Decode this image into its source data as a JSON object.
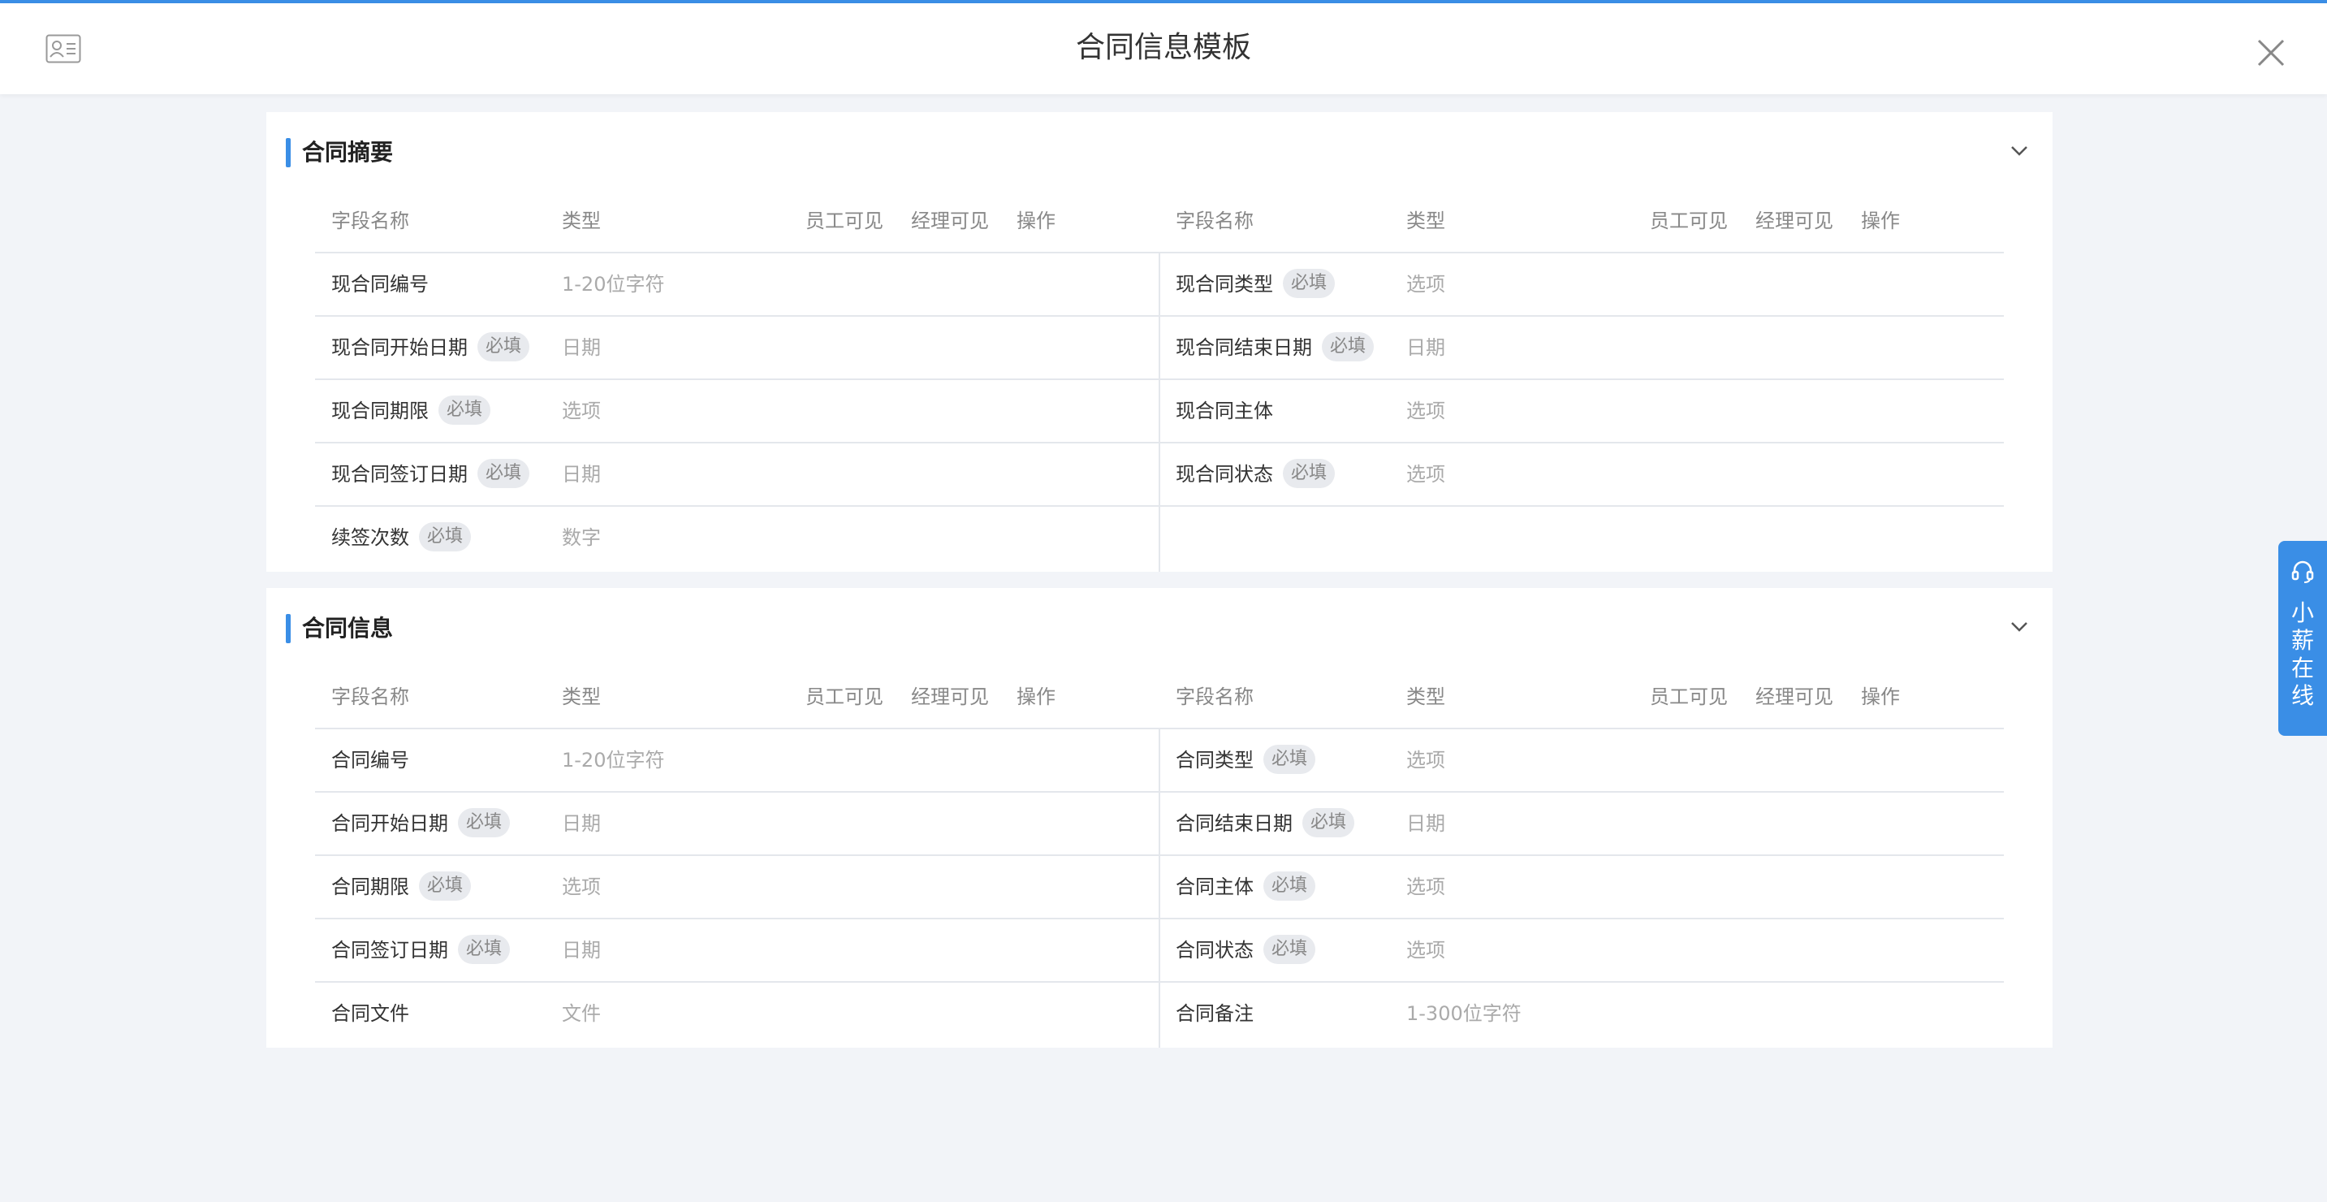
{
  "header": {
    "title": "合同信息模板",
    "left_icon": "contact-card-icon",
    "close_icon": "close-icon"
  },
  "columns": {
    "name": "字段名称",
    "type": "类型",
    "employee_visible": "员工可见",
    "manager_visible": "经理可见",
    "action": "操作"
  },
  "sections": [
    {
      "title": "合同摘要",
      "left": [
        {
          "name": "现合同编号",
          "badge": "",
          "type": "1-20位字符"
        },
        {
          "name": "现合同开始日期",
          "badge": "必填",
          "type": "日期"
        },
        {
          "name": "现合同期限",
          "badge": "必填",
          "type": "选项"
        },
        {
          "name": "现合同签订日期",
          "badge": "必填",
          "type": "日期"
        },
        {
          "name": "续签次数",
          "badge": "必填",
          "type": "数字"
        }
      ],
      "right": [
        {
          "name": "现合同类型",
          "badge": "必填",
          "type": "选项"
        },
        {
          "name": "现合同结束日期",
          "badge": "必填",
          "type": "日期"
        },
        {
          "name": "现合同主体",
          "badge": "",
          "type": "选项"
        },
        {
          "name": "现合同状态",
          "badge": "必填",
          "type": "选项"
        }
      ]
    },
    {
      "title": "合同信息",
      "left": [
        {
          "name": "合同编号",
          "badge": "",
          "type": "1-20位字符"
        },
        {
          "name": "合同开始日期",
          "badge": "必填",
          "type": "日期"
        },
        {
          "name": "合同期限",
          "badge": "必填",
          "type": "选项"
        },
        {
          "name": "合同签订日期",
          "badge": "必填",
          "type": "日期"
        },
        {
          "name": "合同文件",
          "badge": "",
          "type": "文件"
        }
      ],
      "right": [
        {
          "name": "合同类型",
          "badge": "必填",
          "type": "选项"
        },
        {
          "name": "合同结束日期",
          "badge": "必填",
          "type": "日期"
        },
        {
          "name": "合同主体",
          "badge": "必填",
          "type": "选项"
        },
        {
          "name": "合同状态",
          "badge": "必填",
          "type": "选项"
        },
        {
          "name": "合同备注",
          "badge": "",
          "type": "1-300位字符"
        }
      ]
    }
  ],
  "online_service": {
    "label": "小薪在线",
    "icon": "headset-icon",
    "color": "#3a8ee6"
  }
}
